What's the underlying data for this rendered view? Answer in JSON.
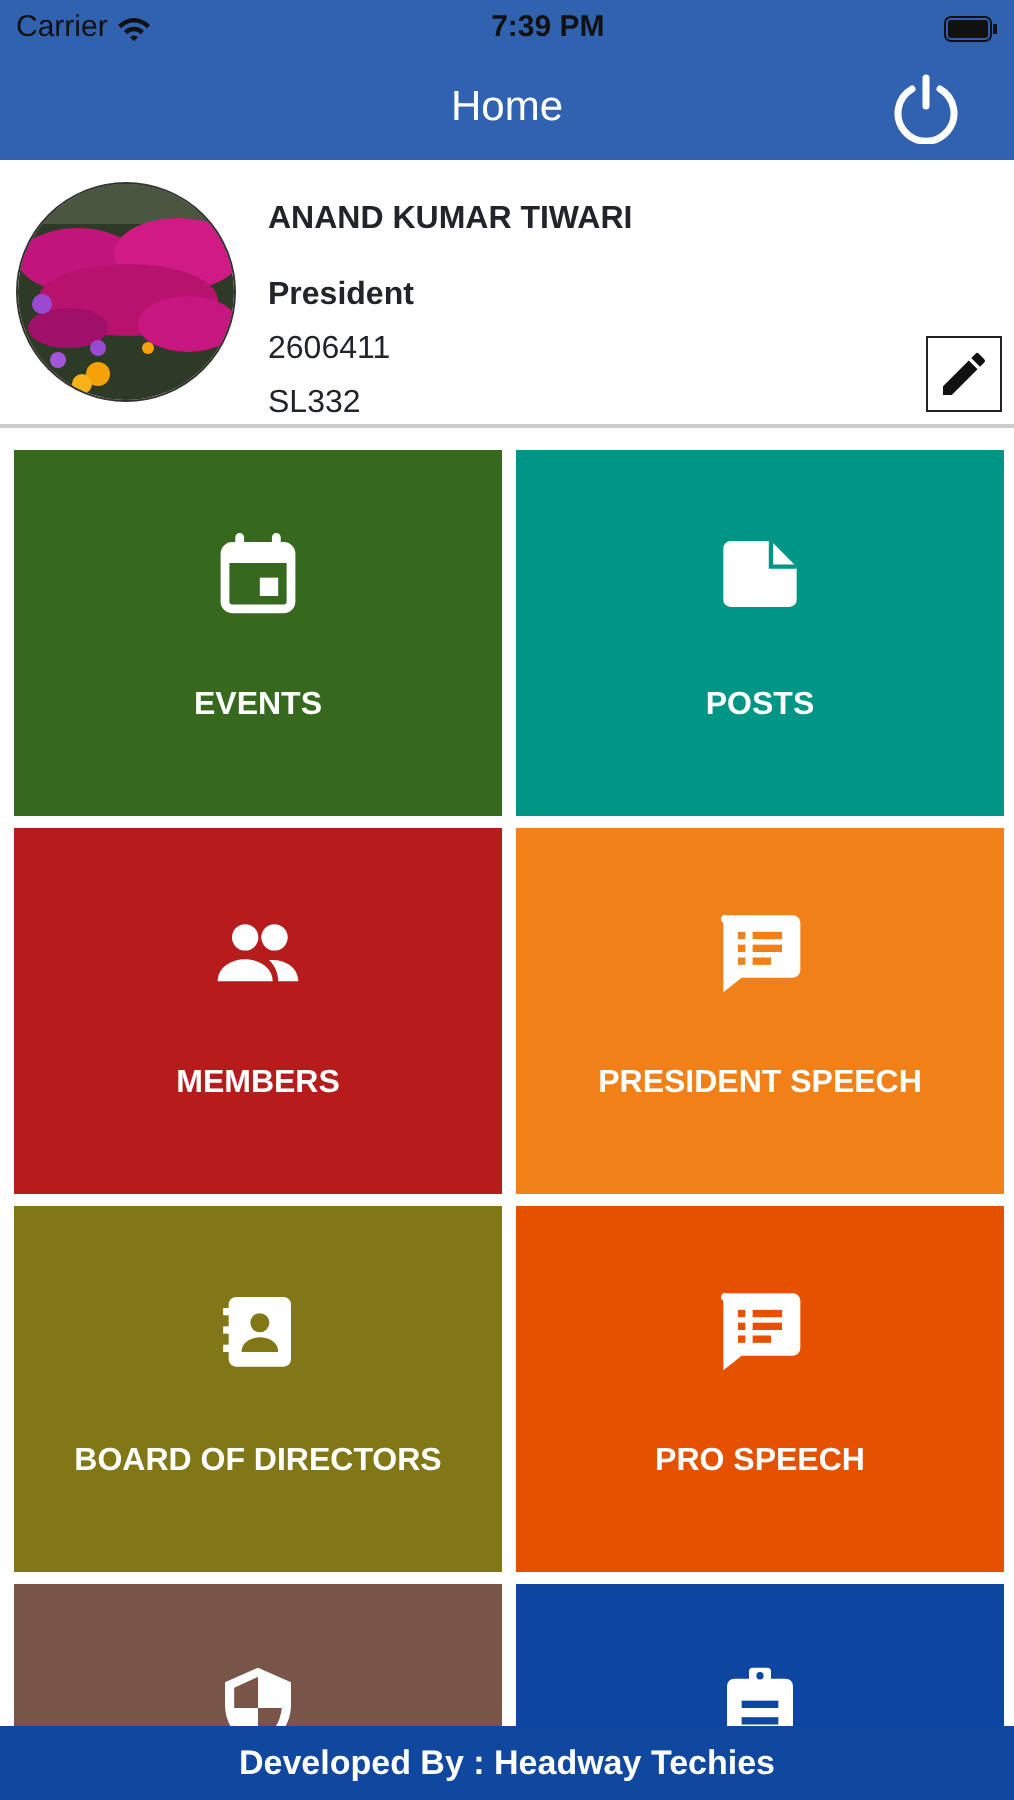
{
  "status_bar": {
    "carrier": "Carrier",
    "time": "7:39 PM"
  },
  "header": {
    "title": "Home"
  },
  "profile": {
    "name": "ANAND KUMAR TIWARI",
    "role": "President",
    "number": "2606411",
    "code": "SL332"
  },
  "tiles": [
    {
      "label": "EVENTS",
      "kind": "calendar",
      "color": "#36691e"
    },
    {
      "label": "POSTS",
      "kind": "document",
      "color": "#009685"
    },
    {
      "label": "MEMBERS",
      "kind": "people",
      "color": "#b71c1c"
    },
    {
      "label": "PRESIDENT SPEECH",
      "kind": "speech",
      "color": "#f28019"
    },
    {
      "label": "BOARD OF DIRECTORS",
      "kind": "contact",
      "color": "#827717"
    },
    {
      "label": "PRO SPEECH",
      "kind": "speech",
      "color": "#e65100"
    },
    {
      "kind": "shield",
      "color": "#795548"
    },
    {
      "kind": "clipboard",
      "color": "#0d47a1"
    }
  ],
  "footer": {
    "text": "Developed By : Headway Techies"
  }
}
